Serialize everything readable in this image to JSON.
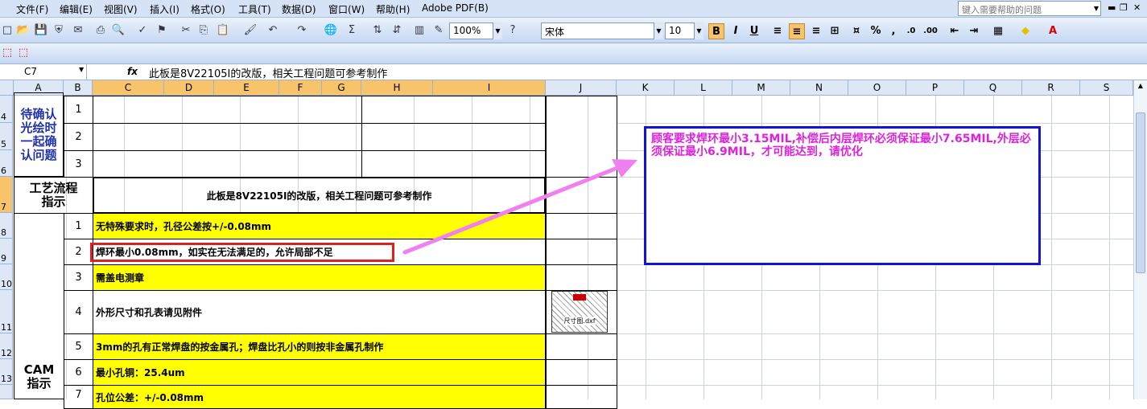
{
  "menu": {
    "items": [
      "文件(F)",
      "编辑(E)",
      "视图(V)",
      "插入(I)",
      "格式(O)",
      "工具(T)",
      "数据(D)",
      "窗口(W)",
      "帮助(H)",
      "Adobe PDF(B)"
    ],
    "help_placeholder": "键入需要帮助的问题"
  },
  "toolbar": {
    "zoom": "100%",
    "font_name": "宋体",
    "font_size": "10",
    "bold_label": "B",
    "italic_label": "I",
    "underline_label": "U",
    "percent_label": "%",
    "comma_label": ",",
    "sigma_label": "Σ"
  },
  "formula_bar": {
    "cell_ref": "C7",
    "fx": "fx",
    "content": "此板是8V22105I的改版，相关工程问题可参考制作"
  },
  "columns": [
    "A",
    "B",
    "C",
    "D",
    "E",
    "F",
    "G",
    "H",
    "I",
    "J",
    "K",
    "L",
    "M",
    "N",
    "O",
    "P",
    "Q",
    "R",
    "S"
  ],
  "rows": [
    "4",
    "5",
    "6",
    "7",
    "8",
    "9",
    "10",
    "11",
    "12",
    "13"
  ],
  "sheet": {
    "a_confirm": "待确认光绘时一起确认问题",
    "confirm_nums": [
      "1",
      "2",
      "3"
    ],
    "a_process": "工艺流程指示",
    "c7_text": "此板是8V22105I的改版，相关工程问题可参考制作",
    "a_cam": "CAM指示",
    "cam_nums": [
      "1",
      "2",
      "3",
      "4",
      "5",
      "6",
      "7"
    ],
    "cam_items": [
      "无特殊要求时，孔径公差按+/-0.08mm",
      "焊环最小0.08mm，如实在无法满足的，允许局部不足",
      "需盖电测章",
      "外形尺寸和孔表请见附件",
      "3mm的孔有正常焊盘的按金属孔；焊盘比孔小的则按非金属孔制作",
      "最小孔铜：25.4um",
      "孔位公差：+/-0.08mm"
    ],
    "attachment_label": "尺寸图.dxf"
  },
  "note": {
    "text": "顾客要求焊环最小3.15MIL,补偿后内层焊环必须保证最小7.65MIL,外层必须保证最小6.9MIL，才可能达到，请优化"
  },
  "colors": {
    "note_border": "#1212d8",
    "note_text": "#dd22dd",
    "highlight_fill": "#ffff00",
    "red_frame": "#e02020",
    "arrow": "#f080f0"
  }
}
